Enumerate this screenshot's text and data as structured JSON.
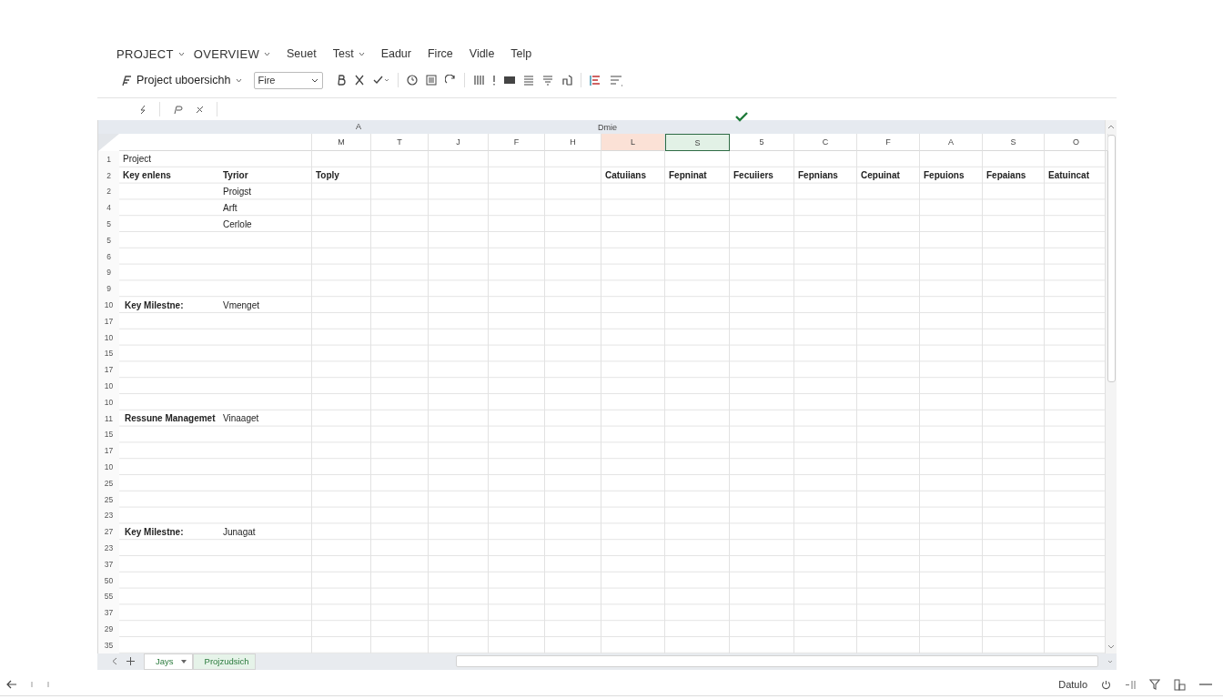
{
  "menu": [
    {
      "label": "PROJECT",
      "dropdown": true
    },
    {
      "label": "OVERVIEW",
      "dropdown": true
    },
    {
      "label": "Seuet",
      "dropdown": false
    },
    {
      "label": "Test",
      "dropdown": true
    },
    {
      "label": "Eadur",
      "dropdown": false
    },
    {
      "label": "Firce",
      "dropdown": false
    },
    {
      "label": "Vidle",
      "dropdown": false
    },
    {
      "label": "Telp",
      "dropdown": false
    }
  ],
  "toolbar": {
    "workbook": "Project uboersichh",
    "font": "Fire"
  },
  "band": {
    "left": "A",
    "right": "Dmie"
  },
  "columns": [
    {
      "label": "M",
      "highlighted": false,
      "selected": false
    },
    {
      "label": "T",
      "highlighted": false,
      "selected": false
    },
    {
      "label": "J",
      "highlighted": false,
      "selected": false
    },
    {
      "label": "F",
      "highlighted": false,
      "selected": false
    },
    {
      "label": "H",
      "highlighted": false,
      "selected": false
    },
    {
      "label": "L",
      "highlighted": true,
      "selected": false
    },
    {
      "label": "S",
      "highlighted": false,
      "selected": true
    },
    {
      "label": "5",
      "highlighted": false,
      "selected": false
    },
    {
      "label": "C",
      "highlighted": false,
      "selected": false
    },
    {
      "label": "F",
      "highlighted": false,
      "selected": false
    },
    {
      "label": "A",
      "highlighted": false,
      "selected": false
    },
    {
      "label": "S",
      "highlighted": false,
      "selected": false
    },
    {
      "label": "O",
      "highlighted": false,
      "selected": false
    }
  ],
  "rows": [
    {
      "label": "1",
      "column_a": "Project",
      "bold": false
    },
    {
      "label": "2",
      "header": true,
      "column_a": "Key enlens",
      "column_b": "Tyrior",
      "column_m": "Toply",
      "columns_l_to_o": [
        "Catuiians",
        "Fepninat",
        "Fecuiiers",
        "Fepnians",
        "Cepuinat",
        "Fepuions",
        "Fepaians",
        "Eatuincat"
      ]
    },
    {
      "label": "2",
      "column_b": "Proigst"
    },
    {
      "label": "4",
      "column_b": "Arft"
    },
    {
      "label": "5",
      "column_b": "Cerlole"
    },
    {
      "label": "5"
    },
    {
      "label": "6"
    },
    {
      "label": "9"
    },
    {
      "label": "9"
    },
    {
      "label": "10",
      "column_a": "Key Milestne:",
      "bold": true,
      "column_b": "Vmenget"
    },
    {
      "label": "17"
    },
    {
      "label": "10"
    },
    {
      "label": "15"
    },
    {
      "label": "17"
    },
    {
      "label": "10"
    },
    {
      "label": "10"
    },
    {
      "label": "11",
      "column_a": "Ressune Managemet",
      "bold": true,
      "column_b": "Vinaaget"
    },
    {
      "label": "15"
    },
    {
      "label": "17"
    },
    {
      "label": "10"
    },
    {
      "label": "25"
    },
    {
      "label": "25"
    },
    {
      "label": "23"
    },
    {
      "label": "27",
      "column_a": "Key Milestne:",
      "bold": true,
      "column_b": "Junagat"
    },
    {
      "label": "23"
    },
    {
      "label": "37"
    },
    {
      "label": "50"
    },
    {
      "label": "55"
    },
    {
      "label": "37"
    },
    {
      "label": "29"
    },
    {
      "label": "35"
    }
  ],
  "sheets": [
    {
      "label": "Jays",
      "dropdown": true,
      "selected": false
    },
    {
      "label": "Projzudsich",
      "dropdown": false,
      "selected": true
    }
  ],
  "status": {
    "label": "Datulo"
  }
}
